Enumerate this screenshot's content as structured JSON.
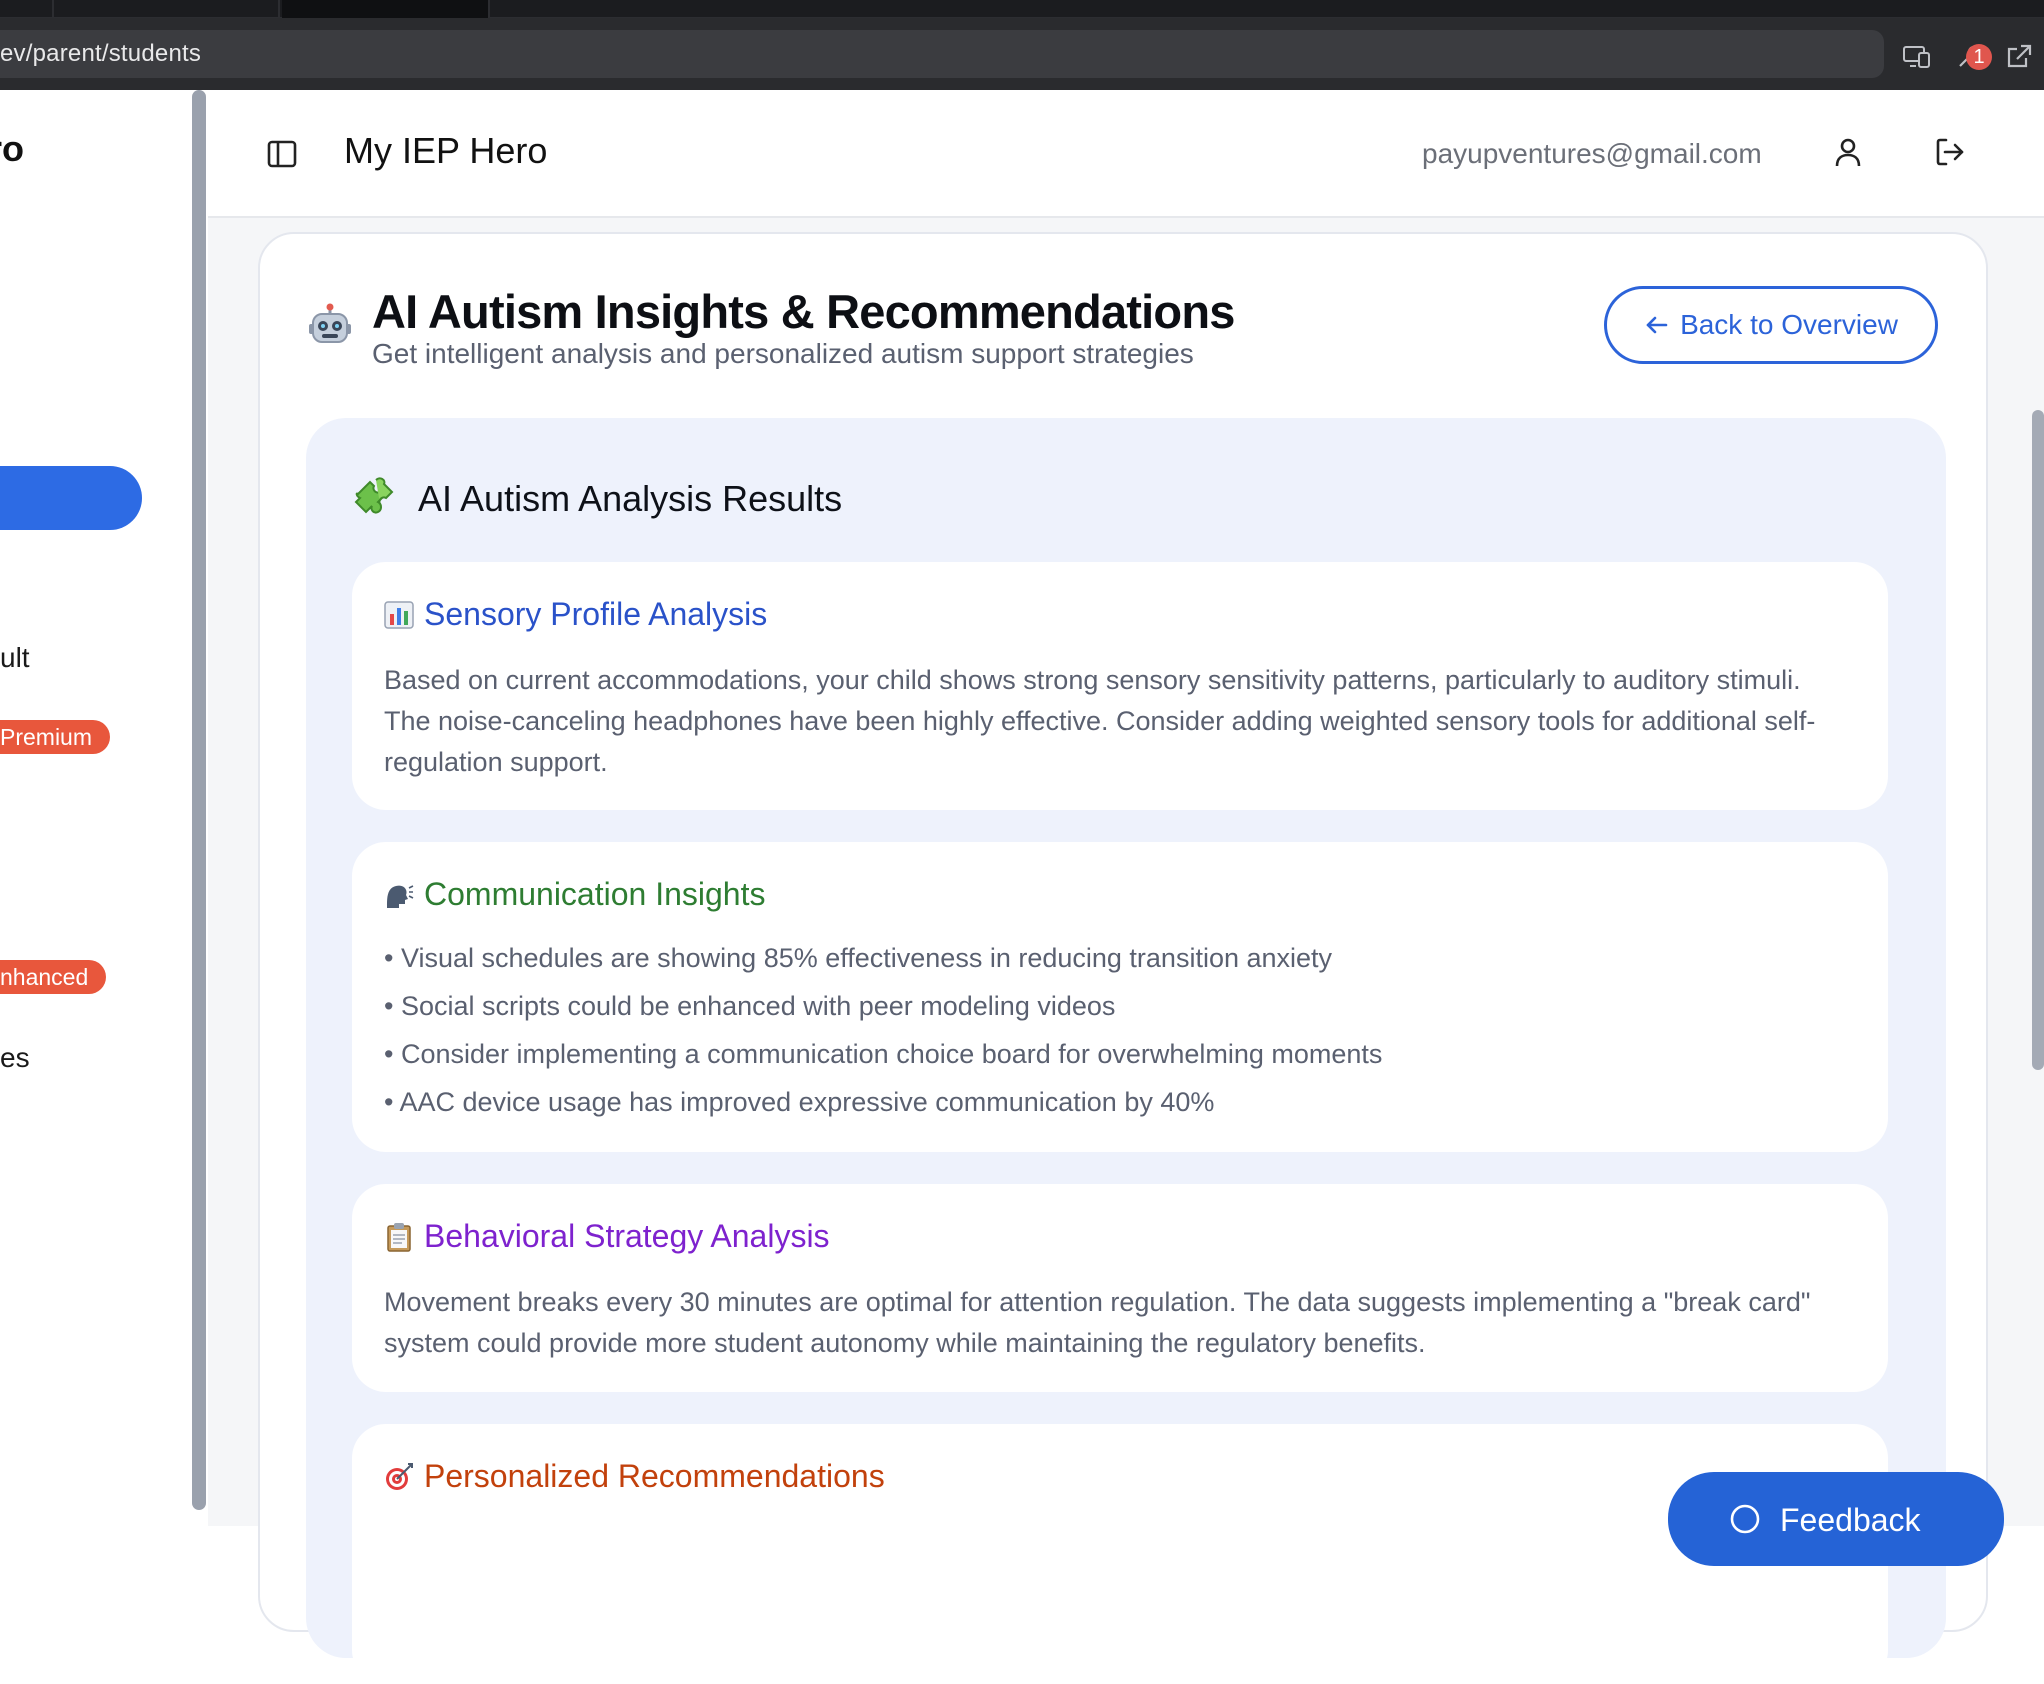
{
  "browser": {
    "url": "ev/parent/students",
    "notification_count": "1"
  },
  "sidebar": {
    "brand_fragment": "ro",
    "items": [
      {
        "label": "ult"
      },
      {
        "label": "es"
      }
    ],
    "badges": [
      {
        "label": "Premium"
      },
      {
        "label": "nhanced"
      }
    ]
  },
  "header": {
    "app_title": "My IEP Hero",
    "user_email": "payupventures@gmail.com"
  },
  "card": {
    "title": "AI Autism Insights & Recommendations",
    "subtitle": "Get intelligent analysis and personalized autism support strategies",
    "back_button": "Back to Overview"
  },
  "results": {
    "title": "AI Autism Analysis Results",
    "sections": [
      {
        "title": "Sensory Profile Analysis",
        "icon": "bar-chart-icon",
        "color": "#2a52c9",
        "body": "Based on current accommodations, your child shows strong sensory sensitivity patterns, particularly to auditory stimuli. The noise-canceling headphones have been highly effective. Consider adding weighted sensory tools for additional self-regulation support."
      },
      {
        "title": "Communication Insights",
        "icon": "speaking-head-icon",
        "color": "#2e7d32",
        "bullets": [
          "Visual schedules are showing 85% effectiveness in reducing transition anxiety",
          "Social scripts could be enhanced with peer modeling videos",
          "Consider implementing a communication choice board for overwhelming moments",
          "AAC device usage has improved expressive communication by 40%"
        ]
      },
      {
        "title": "Behavioral Strategy Analysis",
        "icon": "clipboard-icon",
        "color": "#7e22ce",
        "body": "Movement breaks every 30 minutes are optimal for attention regulation. The data suggests implementing a \"break card\" system could provide more student autonomy while maintaining the regulatory benefits."
      },
      {
        "title": "Personalized Recommendations",
        "icon": "target-icon",
        "color": "#c2410c"
      }
    ]
  },
  "feedback": {
    "label": "Feedback"
  },
  "colors": {
    "primary": "#2c63d9",
    "badge": "#e8573c",
    "panel": "#eef2fc"
  }
}
